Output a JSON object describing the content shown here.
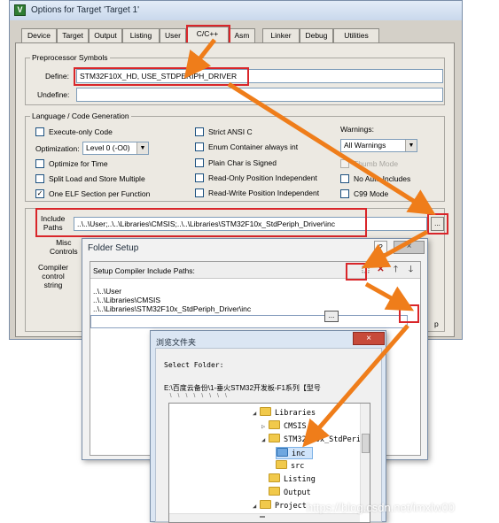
{
  "options": {
    "title": "Options for Target 'Target 1'",
    "tabs": [
      "Device",
      "Target",
      "Output",
      "Listing",
      "User",
      "C/C++",
      "Asm",
      "Linker",
      "Debug",
      "Utilities"
    ],
    "active_tab": "C/C++",
    "preprocessor": {
      "legend": "Preprocessor Symbols",
      "define_label": "Define:",
      "define_value": "STM32F10X_HD, USE_STDPERIPH_DRIVER",
      "undefine_label": "Undefine:",
      "undefine_value": ""
    },
    "codegen": {
      "legend": "Language / Code Generation",
      "execute_only": "Execute-only Code",
      "optimization_label": "Optimization:",
      "optimization_value": "Level 0 (-O0)",
      "optimize_time": "Optimize for Time",
      "split_load": "Split Load and Store Multiple",
      "one_elf": "One ELF Section per Function",
      "strict_ansi": "Strict ANSI C",
      "enum_container": "Enum Container always int",
      "plain_char": "Plain Char is Signed",
      "ro_position": "Read-Only Position Independent",
      "rw_position": "Read-Write Position Independent",
      "warnings_label": "Warnings:",
      "warnings_value": "All Warnings",
      "thumb_mode": "Thumb Mode",
      "no_auto_includes": "No Auto Includes",
      "c99_mode": "C99 Mode"
    },
    "include_paths_label": "Include\nPaths",
    "include_paths_value": "..\\..\\User;..\\..\\Libraries\\CMSIS;..\\..\\Libraries\\STM32F10x_StdPeriph_Driver\\inc",
    "browse_button": "...",
    "misc_controls_label": "Misc\nControls",
    "compiler_string_label": "Compiler\ncontrol\nstring",
    "help_button_partial": "p"
  },
  "folder_setup": {
    "title": "Folder Setup",
    "help_icon": "?",
    "close_icon": "×",
    "header_label": "Setup Compiler Include Paths:",
    "toolbar": {
      "new": "⬚",
      "delete": "✕",
      "up": "🡑",
      "down": "🡓"
    },
    "paths": [
      "..\\..\\User",
      "..\\..\\Libraries\\CMSIS",
      "..\\..\\Libraries\\STM32F10x_StdPeriph_Driver\\inc"
    ],
    "browse_button": "..."
  },
  "browse_folder": {
    "title": "浏览文件夹",
    "close_icon": "×",
    "select_label": "Select Folder:",
    "path_line1": "E:\\百度云备份\\1-垂火STM32开发板-F1系列【型号",
    "path_line2": "...\\...\\...\\...\\...\\...\\...\\...\\...",
    "tree": [
      {
        "label": "Libraries",
        "level": 0,
        "expanded": true
      },
      {
        "label": "CMSIS",
        "level": 1,
        "expanded": false
      },
      {
        "label": "STM32F10x_StdPeriph",
        "level": 1,
        "expanded": true
      },
      {
        "label": "inc",
        "level": 2,
        "selected": true
      },
      {
        "label": "src",
        "level": 2
      },
      {
        "label": "Listing",
        "level": 0
      },
      {
        "label": "Output",
        "level": 0
      },
      {
        "label": "Project",
        "level": 0,
        "expanded": true
      }
    ]
  },
  "watermark": "https://blog.csdn.net/imxlw00",
  "colors": {
    "highlight": "#d9262a",
    "arrow": "#ef7d1a",
    "selection": "#cfe4fb"
  }
}
